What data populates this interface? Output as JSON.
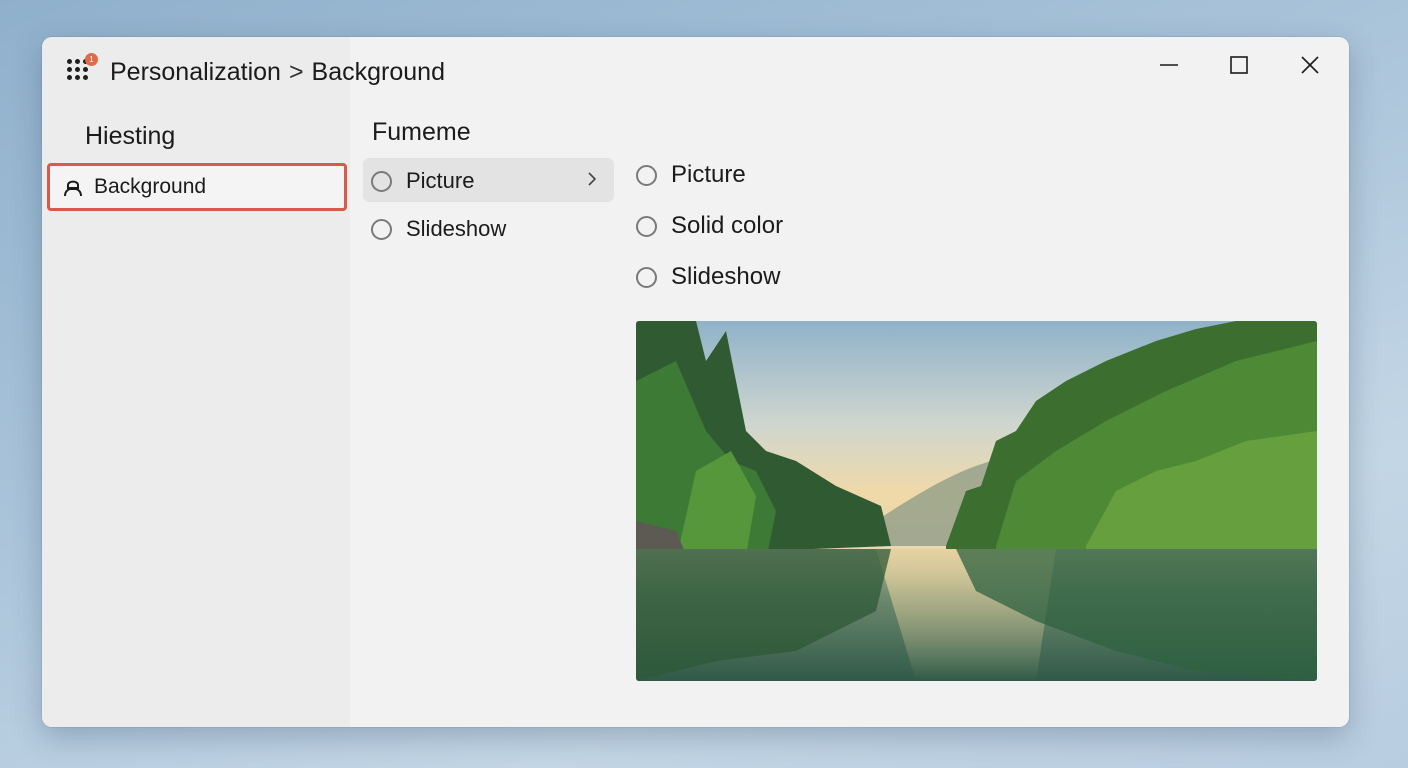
{
  "titlebar": {
    "badge": "1",
    "breadcrumb_section": "Personalization",
    "breadcrumb_separator": ">",
    "breadcrumb_page": "Background",
    "icons": [
      "apps-grid-icon",
      "minimize-icon",
      "maximize-icon",
      "close-icon"
    ]
  },
  "sidebar": {
    "heading": "Hiesting",
    "items": [
      {
        "label": "Background",
        "icon": "person-icon",
        "selected": true
      }
    ]
  },
  "middle": {
    "heading": "Fumeme",
    "options": [
      {
        "label": "Picture",
        "selected_row": true,
        "has_chevron": true
      },
      {
        "label": "Slideshow",
        "selected_row": false,
        "has_chevron": false
      }
    ]
  },
  "right": {
    "options": [
      {
        "label": "Picture"
      },
      {
        "label": "Solid color"
      },
      {
        "label": "Slideshow"
      }
    ]
  },
  "colors": {
    "selection_outline": "#d85a48",
    "badge": "#e06a4a",
    "window_bg": "#f2f2f2",
    "sidebar_bg": "#ececec"
  }
}
